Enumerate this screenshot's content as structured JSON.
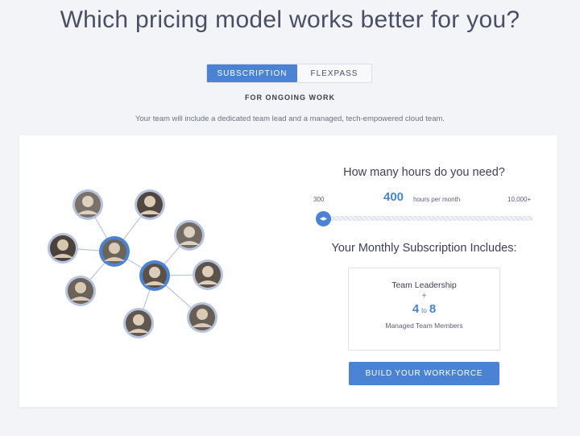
{
  "headline": "Which pricing model works better for you?",
  "pricing_toggle": {
    "options": [
      "SUBSCRIPTION",
      "FLEXPASS"
    ],
    "selected": "SUBSCRIPTION"
  },
  "model_label": "FOR ONGOING WORK",
  "model_description": "Your team will include a dedicated team lead and a managed, tech-empowered cloud team.",
  "hours": {
    "question": "How many hours do you need?",
    "min_label": "300",
    "max_label": "10,000+",
    "value": "400",
    "unit": "hours per month",
    "slider_fraction": 0.0
  },
  "includes": {
    "title": "Your Monthly Subscription Includes:",
    "lead": "Team Leadership",
    "plus": "+",
    "range_from": "4",
    "range_to_word": "to",
    "range_to": "8",
    "members": "Managed Team Members"
  },
  "cta_label": "BUILD YOUR WORKFORCE",
  "colors": {
    "accent": "#4a83d4",
    "background": "#f3f4f8",
    "card": "#ffffff"
  }
}
